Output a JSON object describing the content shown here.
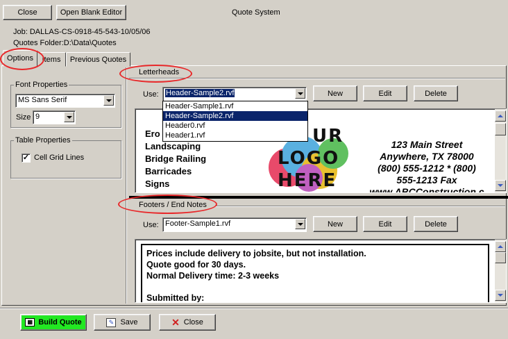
{
  "toolbar": {
    "close_label": "Close",
    "open_blank_label": "Open Blank Editor",
    "title": "Quote System"
  },
  "info": {
    "job": "Job: DALLAS-CS-0918-45-543-10/05/06",
    "folder": "Quotes Folder:D:\\Data\\Quotes"
  },
  "tabs": [
    {
      "label": "Options"
    },
    {
      "label": "Items"
    },
    {
      "label": "Previous Quotes"
    }
  ],
  "font_properties": {
    "title": "Font Properties",
    "font": "MS Sans Serif",
    "size_label": "Size",
    "size": "9"
  },
  "table_properties": {
    "title": "Table Properties",
    "cell_grid_label": "Cell Grid Lines",
    "cell_grid_checked": true
  },
  "letterheads": {
    "title": "Letterheads",
    "use_label": "Use:",
    "selected": "Header-Sample2.rvf",
    "new_label": "New",
    "edit_label": "Edit",
    "delete_label": "Delete",
    "options": [
      "Header-Sample1.rvf",
      "Header-Sample2.rvf",
      "Header0.rvf",
      "Header1.rvf"
    ],
    "preview_left": [
      "Ero",
      "Landscaping",
      "Bridge Railing",
      "Barricades",
      "Signs"
    ],
    "logo": [
      "UR",
      "LOGO",
      "HERE"
    ],
    "address": [
      "123 Main Street",
      "Anywhere, TX 78000",
      "(800) 555-1212 * (800)",
      "555-1213 Fax",
      "www.ABCConstruction.c"
    ]
  },
  "footers": {
    "title": "Footers / End Notes",
    "use_label": "Use:",
    "selected": "Footer-Sample1.rvf",
    "new_label": "New",
    "edit_label": "Edit",
    "delete_label": "Delete",
    "lines": [
      "Prices include delivery to jobsite, but not installation.",
      "Quote good for 30 days.",
      "Normal Delivery time: 2-3 weeks",
      "",
      "Submitted by:"
    ]
  },
  "bottom": {
    "build_label": "Build Quote",
    "save_label": "Save",
    "close_label": "Close"
  },
  "colors": {
    "annotation": "#e8282a",
    "highlight": "#0a246a",
    "build": "#22e822"
  }
}
